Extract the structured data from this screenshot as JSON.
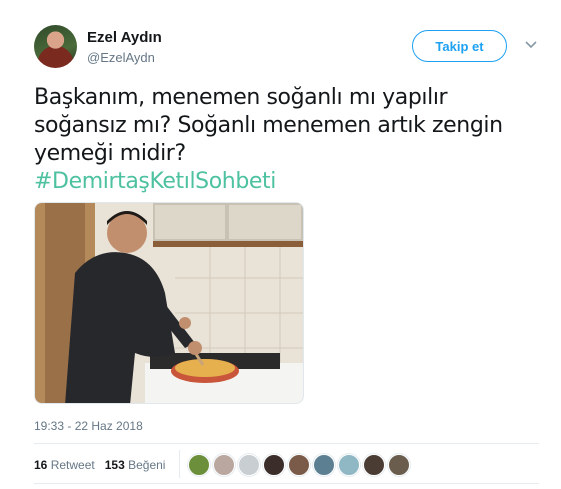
{
  "user": {
    "name": "Ezel Aydın",
    "handle": "@EzelAydn",
    "follow_label": "Takip et"
  },
  "tweet": {
    "text_lines": [
      "Başkanım, menemen soğanlı mı yapılır",
      "soğansız mı? Soğanlı menemen artık zengin",
      "yemeği midir?"
    ],
    "hashtag": "#DemirtaşKetılSohbeti",
    "timestamp": "19:33 - 22 Haz 2018"
  },
  "stats": {
    "retweets_count": "16",
    "retweets_label": "Retweet",
    "likes_count": "153",
    "likes_label": "Beğeni"
  },
  "liker_colors": [
    "#6b8f3a",
    "#b9a7a0",
    "#c9ced3",
    "#3b2d2a",
    "#7a5a48",
    "#5d7f92",
    "#8fb7c4",
    "#4a3b33",
    "#6a5d4d"
  ],
  "colors": {
    "accent": "#1da1f2",
    "hashtag": "#4dc1a0",
    "text": "#14171a",
    "muted": "#657786"
  }
}
